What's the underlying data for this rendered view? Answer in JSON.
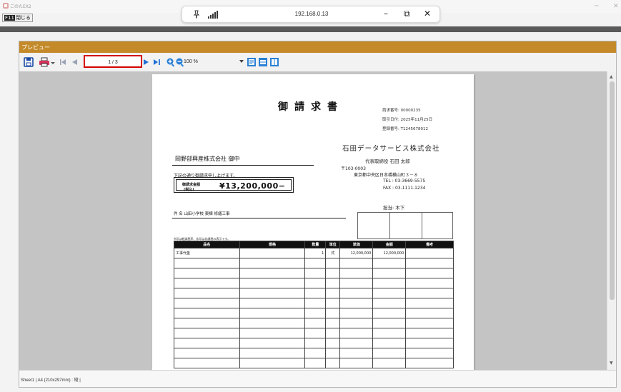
{
  "window": {
    "app_title": "ごのたEX2",
    "minimize": "─",
    "close": "✕"
  },
  "remote": {
    "host": "192.168.0.13",
    "pin_icon": "pin-icon",
    "signal_icon": "signal-strength-icon",
    "minimize": "–",
    "restore": "⧉",
    "close": "✕"
  },
  "f11": {
    "key": "F11",
    "label": "閉じる"
  },
  "preview": {
    "title": "プレビュー",
    "toolbar": {
      "page_value": "1 / 3",
      "zoom_value": "100 %"
    },
    "status": "Sheet1 | A4 (210x297mm) : 縦 |"
  },
  "invoice": {
    "title": "御請求書",
    "invoice_number": "請求番号: 00000235",
    "transaction_date": "取引日付: 2025年11月25日",
    "registration_number": "登録番号: T1245678012",
    "issuer_name": "石田データサービス株式会社",
    "representative": "代表取締役 石田 太郎",
    "postal_code": "〒103-0003",
    "address": "東京都中央区日本橋横山町３－８",
    "tel": "TEL : 03-3669-5575",
    "fax": "FAX : 03-1111-1234",
    "person_in_charge": "担当: 木下",
    "customer": "岡野部興産株式会社  御中",
    "intro_text": "下記の通り御請求申し上げます。",
    "total_label_line1": "御請求金額",
    "total_label_line2": "(税込)",
    "total_amount": "¥13,200,000−",
    "subject": "件 名  山田小学校 東棟 修繕工事",
    "note": "※印は軽減税率、非印は非課税の表示です。",
    "table": {
      "headers": [
        "品名",
        "規格",
        "数量",
        "単位",
        "単価",
        "金額",
        "備考"
      ],
      "rows": [
        [
          "工事代金",
          "",
          "1",
          "式",
          "12,000,000",
          "12,000,000",
          ""
        ]
      ]
    }
  }
}
